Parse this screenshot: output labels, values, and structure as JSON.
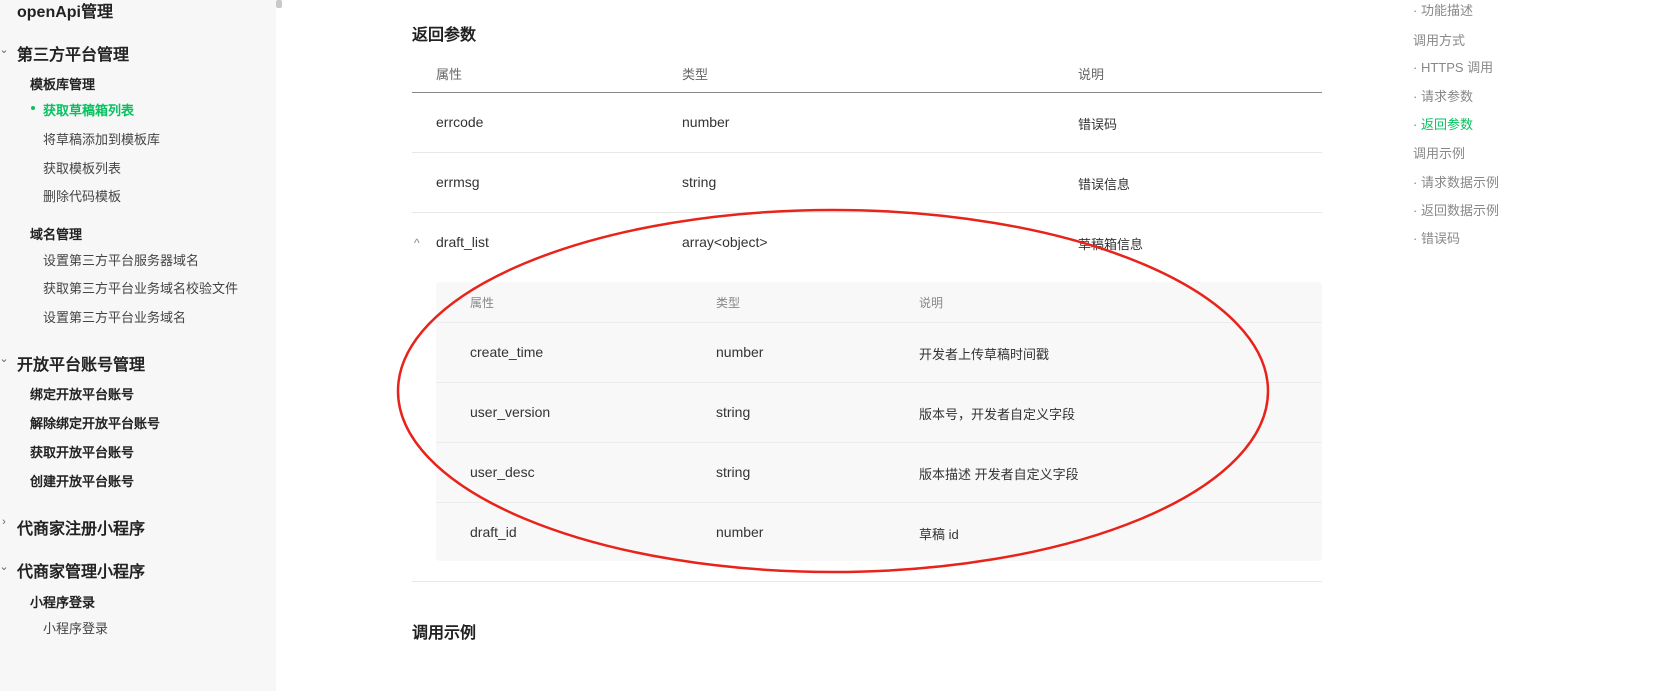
{
  "sidebar": {
    "top_title": "openApi管理",
    "group_3rd": "第三方平台管理",
    "sub_template": "模板库管理",
    "item_draft_list": "获取草稿箱列表",
    "item_add_draft": "将草稿添加到模板库",
    "item_template_list": "获取模板列表",
    "item_delete_template": "删除代码模板",
    "sub_domain": "域名管理",
    "item_set_server_domain": "设置第三方平台服务器域名",
    "item_get_verify_file": "获取第三方平台业务域名校验文件",
    "item_set_biz_domain": "设置第三方平台业务域名",
    "group_open": "开放平台账号管理",
    "item_bind": "绑定开放平台账号",
    "item_unbind": "解除绑定开放平台账号",
    "item_get_open": "获取开放平台账号",
    "item_create_open": "创建开放平台账号",
    "group_register": "代商家注册小程序",
    "group_manage": "代商家管理小程序",
    "sub_login": "小程序登录",
    "item_login": "小程序登录"
  },
  "main": {
    "section_return": "返回参数",
    "headers": {
      "attr": "属性",
      "type": "类型",
      "desc": "说明"
    },
    "rows": [
      {
        "name": "errcode",
        "type": "number",
        "desc": "错误码"
      },
      {
        "name": "errmsg",
        "type": "string",
        "desc": "错误信息"
      },
      {
        "name": "draft_list",
        "type": "array<object>",
        "desc": "草稿箱信息"
      }
    ],
    "nested_headers": {
      "attr": "属性",
      "type": "类型",
      "desc": "说明"
    },
    "nested_rows": [
      {
        "name": "create_time",
        "type": "number",
        "desc": "开发者上传草稿时间戳"
      },
      {
        "name": "user_version",
        "type": "string",
        "desc": "版本号，开发者自定义字段"
      },
      {
        "name": "user_desc",
        "type": "string",
        "desc": "版本描述 开发者自定义字段"
      },
      {
        "name": "draft_id",
        "type": "number",
        "desc": "草稿 id"
      }
    ],
    "section_example": "调用示例"
  },
  "toc": {
    "func_desc": "· 功能描述",
    "call_method": "调用方式",
    "https_call": "· HTTPS 调用",
    "request_params": "· 请求参数",
    "return_params": "· 返回参数",
    "call_example": "调用示例",
    "request_example": "· 请求数据示例",
    "return_example": "· 返回数据示例",
    "error_code": "· 错误码"
  },
  "colors": {
    "accent": "#07c160",
    "annotation": "#e8231a"
  }
}
